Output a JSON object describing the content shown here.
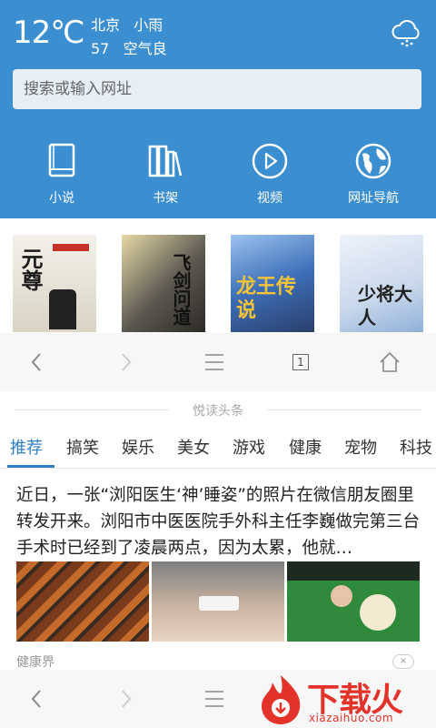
{
  "weather": {
    "temperature": "12℃",
    "city": "北京",
    "condition": "小雨",
    "aqi_value": "57",
    "aqi_label": "空气良",
    "icon": "cloud-rain-icon"
  },
  "search": {
    "placeholder": "搜索或输入网址"
  },
  "quick_links": [
    {
      "label": "小说",
      "icon": "book-icon"
    },
    {
      "label": "书架",
      "icon": "bookshelf-icon"
    },
    {
      "label": "视频",
      "icon": "play-icon"
    },
    {
      "label": "网址导航",
      "icon": "globe-icon"
    }
  ],
  "books": [
    {
      "title": "元尊",
      "color": "#1b1b1b"
    },
    {
      "title": "飞剑问道",
      "color": "#6e6a62"
    },
    {
      "title": "龙王传说",
      "color": "#5d8fd1"
    },
    {
      "title": "少将大人",
      "color": "#d9e4f2"
    }
  ],
  "toolbar": {
    "back_icon": "chevron-left-icon",
    "forward_icon": "chevron-right-icon",
    "menu_icon": "menu-icon",
    "tabs_count": "1",
    "home_icon": "home-icon"
  },
  "news": {
    "section_title": "悦读头条",
    "tabs": [
      "推荐",
      "搞笑",
      "娱乐",
      "美女",
      "游戏",
      "健康",
      "宠物",
      "科技"
    ],
    "active_tab": 0,
    "article_text": "近日，一张“浏阳医生‘神’睡姿”的照片在微信朋友圈里转发开来。浏阳市中医医院手外科主任李巍做完第三台手术时已经到了凌晨两点，因为太累，他就…",
    "source": "健康界",
    "close": "×"
  },
  "watermark": {
    "brand": "下载火",
    "url": "xiazaihuo.com"
  },
  "colors": {
    "header_bg": "#3b8fd0",
    "accent": "#2f7fc7",
    "watermark": "#e2322a"
  }
}
